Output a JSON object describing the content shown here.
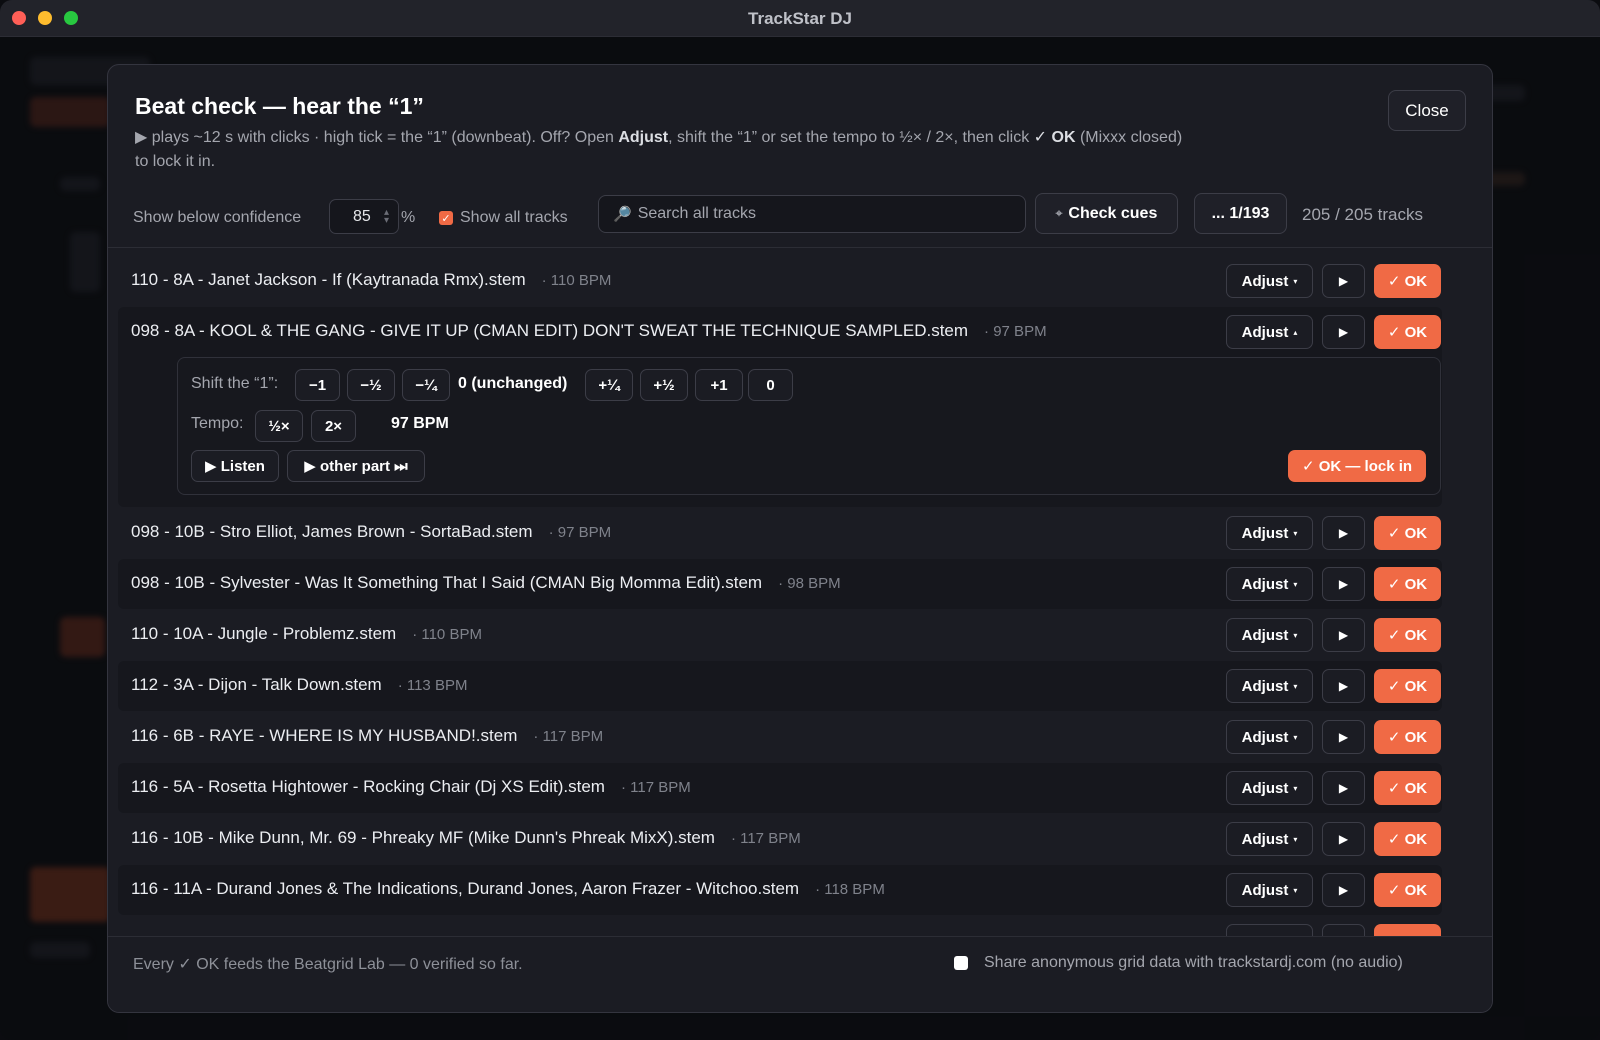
{
  "window": {
    "title": "TrackStar DJ"
  },
  "modal": {
    "title": "Beat check — hear the “1”",
    "desc_a": "▶ plays ~12 s with clicks · high tick = the “1” (downbeat). Off? Open ",
    "desc_adjust": "Adjust",
    "desc_b": ", shift the “1” or set the tempo to ½× / 2×, then click ",
    "desc_ok": "✓ OK",
    "desc_c": " (Mixxx closed) to lock it in.",
    "close_label": "Close"
  },
  "toolbar": {
    "confidence_label": "Show below confidence",
    "confidence_value": "85",
    "percent": "%",
    "show_all_label": "Show all tracks",
    "show_all_checked": true,
    "search_placeholder": "Search all tracks",
    "check_cues_label": "Check cues",
    "pager_label": "... 1/193",
    "track_count": "205 / 205 tracks"
  },
  "tracks": [
    {
      "name": "110 - 8A - Janet Jackson - If (Kaytranada Rmx).stem",
      "bpm": "· 110 BPM",
      "adjust": "Adjust",
      "caret": "▾",
      "play": "▶",
      "ok": "✓ OK"
    },
    {
      "name": "098 - 8A - KOOL & THE GANG - GIVE IT UP (CMAN EDIT) DON'T SWEAT THE TECHNIQUE SAMPLED.stem",
      "bpm": "· 97 BPM",
      "adjust": "Adjust",
      "caret": "▴",
      "play": "▶",
      "ok": "✓ OK"
    },
    {
      "name": "098 - 10B - Stro Elliot, James Brown - SortaBad.stem",
      "bpm": "· 97 BPM",
      "adjust": "Adjust",
      "caret": "▾",
      "play": "▶",
      "ok": "✓ OK"
    },
    {
      "name": "098 - 10B - Sylvester - Was It Something That I Said (CMAN Big Momma Edit).stem",
      "bpm": "· 98 BPM",
      "adjust": "Adjust",
      "caret": "▾",
      "play": "▶",
      "ok": "✓ OK"
    },
    {
      "name": "110 - 10A - Jungle - Problemz.stem",
      "bpm": "· 110 BPM",
      "adjust": "Adjust",
      "caret": "▾",
      "play": "▶",
      "ok": "✓ OK"
    },
    {
      "name": "112 - 3A - Dijon - Talk Down.stem",
      "bpm": "· 113 BPM",
      "adjust": "Adjust",
      "caret": "▾",
      "play": "▶",
      "ok": "✓ OK"
    },
    {
      "name": "116 - 6B - RAYE - WHERE IS MY HUSBAND!.stem",
      "bpm": "· 117 BPM",
      "adjust": "Adjust",
      "caret": "▾",
      "play": "▶",
      "ok": "✓ OK"
    },
    {
      "name": "116 - 5A - Rosetta Hightower - Rocking Chair (Dj XS Edit).stem",
      "bpm": "· 117 BPM",
      "adjust": "Adjust",
      "caret": "▾",
      "play": "▶",
      "ok": "✓ OK"
    },
    {
      "name": "116 - 10B - Mike Dunn, Mr. 69 - Phreaky MF (Mike Dunn's Phreak MixX).stem",
      "bpm": "· 117 BPM",
      "adjust": "Adjust",
      "caret": "▾",
      "play": "▶",
      "ok": "✓ OK"
    },
    {
      "name": "116 - 11A - Durand Jones & The Indications, Durand Jones, Aaron Frazer - Witchoo.stem",
      "bpm": "· 118 BPM",
      "adjust": "Adjust",
      "caret": "▾",
      "play": "▶",
      "ok": "✓ OK"
    }
  ],
  "expanded": {
    "shift_label": "Shift the “1”:",
    "shift_buttons": [
      "−1",
      "−½",
      "−¼",
      "+¼",
      "+½",
      "+1",
      "0"
    ],
    "shift_current": "0 (unchanged)",
    "tempo_label": "Tempo:",
    "tempo_half": "½×",
    "tempo_double": "2×",
    "tempo_bpm": "97 BPM",
    "listen_label": "▶ Listen",
    "other_part_label": "▶ other part ⏭",
    "lock_label": "✓ OK — lock in"
  },
  "footer": {
    "left_text": "Every ✓ OK feeds the Beatgrid Lab — 0 verified so far.",
    "share_label": "Share anonymous grid data with trackstardj.com (no audio)",
    "share_checked": false
  },
  "colors": {
    "accent": "#f06a45",
    "bg": "#1b1c23",
    "border": "#3c3d47"
  }
}
